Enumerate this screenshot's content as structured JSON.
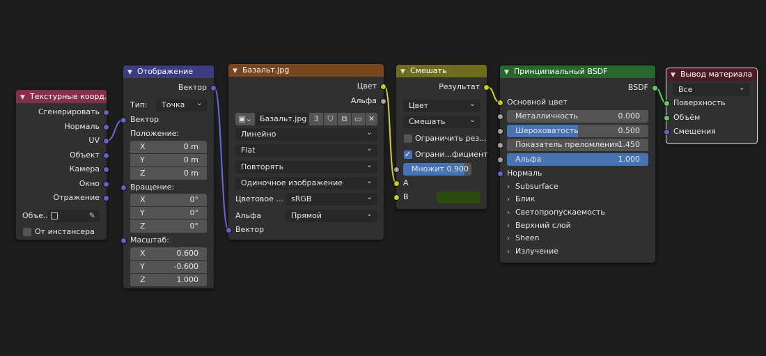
{
  "nodes": {
    "texcoord": {
      "title": "Текстурные коорд...",
      "outputs": [
        "Сгенерировать",
        "Нормаль",
        "UV",
        "Объект",
        "Камера",
        "Окно",
        "Отражение"
      ],
      "object_label": "Объе...",
      "from_instancer": "От инстансера"
    },
    "mapping": {
      "title": "Отображение",
      "output_vector": "Вектор",
      "type_label": "Тип:",
      "type_value": "Точка",
      "input_vector": "Вектор",
      "location_label": "Положение:",
      "location": [
        {
          "k": "X",
          "v": "0 m"
        },
        {
          "k": "Y",
          "v": "0 m"
        },
        {
          "k": "Z",
          "v": "0 m"
        }
      ],
      "rotation_label": "Вращение:",
      "rotation": [
        {
          "k": "X",
          "v": "0°"
        },
        {
          "k": "Y",
          "v": "0°"
        },
        {
          "k": "Z",
          "v": "0°"
        }
      ],
      "scale_label": "Масштаб:",
      "scale": [
        {
          "k": "X",
          "v": "0.600"
        },
        {
          "k": "Y",
          "v": "-0.600"
        },
        {
          "k": "Z",
          "v": "1.000"
        }
      ]
    },
    "image": {
      "title": "Базальт.jpg",
      "out_color": "Цвет",
      "out_alpha": "Альфа",
      "image_name": "Базальт.jpg",
      "users": "3",
      "interpolation": "Линейно",
      "projection": "Flat",
      "extension": "Повторять",
      "source": "Одиночное изображение",
      "colorspace_label": "Цветовое ...",
      "colorspace_value": "sRGB",
      "alpha_label": "Альфа",
      "alpha_value": "Прямой",
      "in_vector": "Вектор"
    },
    "mix": {
      "title": "Смешать",
      "out_result": "Результат",
      "data_type": "Цвет",
      "blend_type": "Смешать",
      "clamp_result": "Ограничить рез...",
      "clamp_factor": "Ограни...фициент",
      "factor_label": "Множит",
      "factor_value": "0.900",
      "in_a": "A",
      "in_b": "B",
      "b_color": "#2d4a0d"
    },
    "bsdf": {
      "title": "Принципиальный BSDF",
      "out_bsdf": "BSDF",
      "base_color": "Основной цвет",
      "metallic_label": "Металличность",
      "metallic_value": "0.000",
      "roughness_label": "Шероховатость",
      "roughness_value": "0.500",
      "ior_label": "Показатель преломления",
      "ior_value": "1.450",
      "alpha_label": "Альфа",
      "alpha_value": "1.000",
      "normal": "Нормаль",
      "panels": [
        "Subsurface",
        "Блик",
        "Светопропускаемость",
        "Верхний слой",
        "Sheen",
        "Излучение"
      ]
    },
    "output": {
      "title": "Вывод материала",
      "target": "Все",
      "in_surface": "Поверхность",
      "in_volume": "Объём",
      "in_displacement": "Смещения"
    }
  },
  "colors": {
    "texcoord_header": "#83314a",
    "mapping_header": "#3c3c83",
    "image_header": "#79461d",
    "mix_header": "#6e6e1d",
    "bsdf_header": "#27672c",
    "output_header": "#4d1a25"
  }
}
